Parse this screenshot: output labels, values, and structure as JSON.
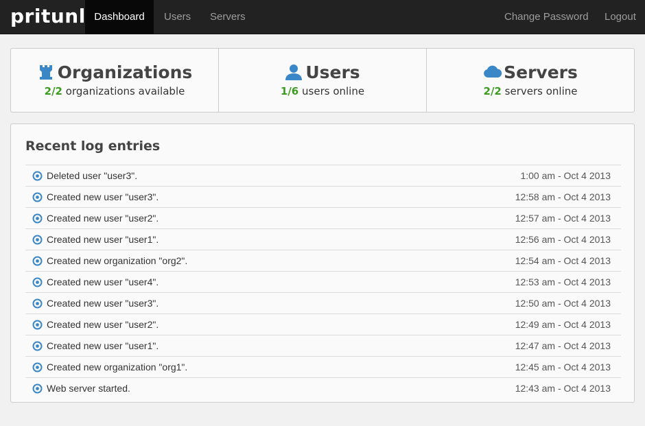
{
  "nav": {
    "brand": "pritunl",
    "items": [
      {
        "label": "Dashboard",
        "active": true
      },
      {
        "label": "Users",
        "active": false
      },
      {
        "label": "Servers",
        "active": false
      }
    ],
    "right": {
      "change_password": "Change Password",
      "logout": "Logout"
    }
  },
  "stats": {
    "organizations": {
      "title": "Organizations",
      "count": "2/2",
      "suffix": "organizations available",
      "icon": "rook-icon"
    },
    "users": {
      "title": "Users",
      "count": "1/6",
      "suffix": "users online",
      "icon": "user-icon"
    },
    "servers": {
      "title": "Servers",
      "count": "2/2",
      "suffix": "servers online",
      "icon": "cloud-icon"
    }
  },
  "colors": {
    "accent": "#3a87c8",
    "count_green": "#3c9c22",
    "navbar": "#222222"
  },
  "logs": {
    "title": "Recent log entries",
    "entries": [
      {
        "message": "Deleted user \"user3\".",
        "time": "1:00 am - Oct 4 2013"
      },
      {
        "message": "Created new user \"user3\".",
        "time": "12:58 am - Oct 4 2013"
      },
      {
        "message": "Created new user \"user2\".",
        "time": "12:57 am - Oct 4 2013"
      },
      {
        "message": "Created new user \"user1\".",
        "time": "12:56 am - Oct 4 2013"
      },
      {
        "message": "Created new organization \"org2\".",
        "time": "12:54 am - Oct 4 2013"
      },
      {
        "message": "Created new user \"user4\".",
        "time": "12:53 am - Oct 4 2013"
      },
      {
        "message": "Created new user \"user3\".",
        "time": "12:50 am - Oct 4 2013"
      },
      {
        "message": "Created new user \"user2\".",
        "time": "12:49 am - Oct 4 2013"
      },
      {
        "message": "Created new user \"user1\".",
        "time": "12:47 am - Oct 4 2013"
      },
      {
        "message": "Created new organization \"org1\".",
        "time": "12:45 am - Oct 4 2013"
      },
      {
        "message": "Web server started.",
        "time": "12:43 am - Oct 4 2013"
      }
    ]
  }
}
